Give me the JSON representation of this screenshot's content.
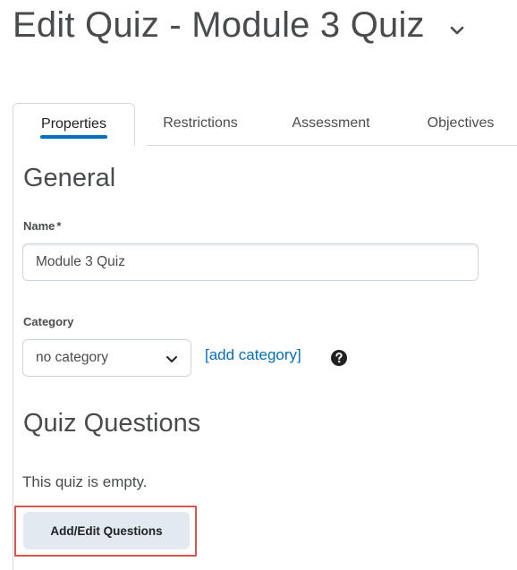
{
  "header": {
    "title": "Edit Quiz - Module 3 Quiz"
  },
  "tabs": [
    {
      "label": "Properties",
      "active": true
    },
    {
      "label": "Restrictions",
      "active": false
    },
    {
      "label": "Assessment",
      "active": false
    },
    {
      "label": "Objectives",
      "active": false
    }
  ],
  "general": {
    "heading": "General",
    "name_label": "Name",
    "required_marker": "*",
    "name_value": "Module 3 Quiz",
    "category_label": "Category",
    "category_selected": "no category",
    "add_category_link": "[add category]"
  },
  "quiz_questions": {
    "heading": "Quiz Questions",
    "empty_message": "This quiz is empty.",
    "button_label": "Add/Edit Questions"
  },
  "colors": {
    "accent": "#006fbf",
    "highlight": "#d9534f",
    "button_bg": "#e3e9f1"
  },
  "icons": {
    "title_menu": "chevron-down-icon",
    "select_menu": "chevron-down-icon",
    "help": "question-circle-icon"
  }
}
